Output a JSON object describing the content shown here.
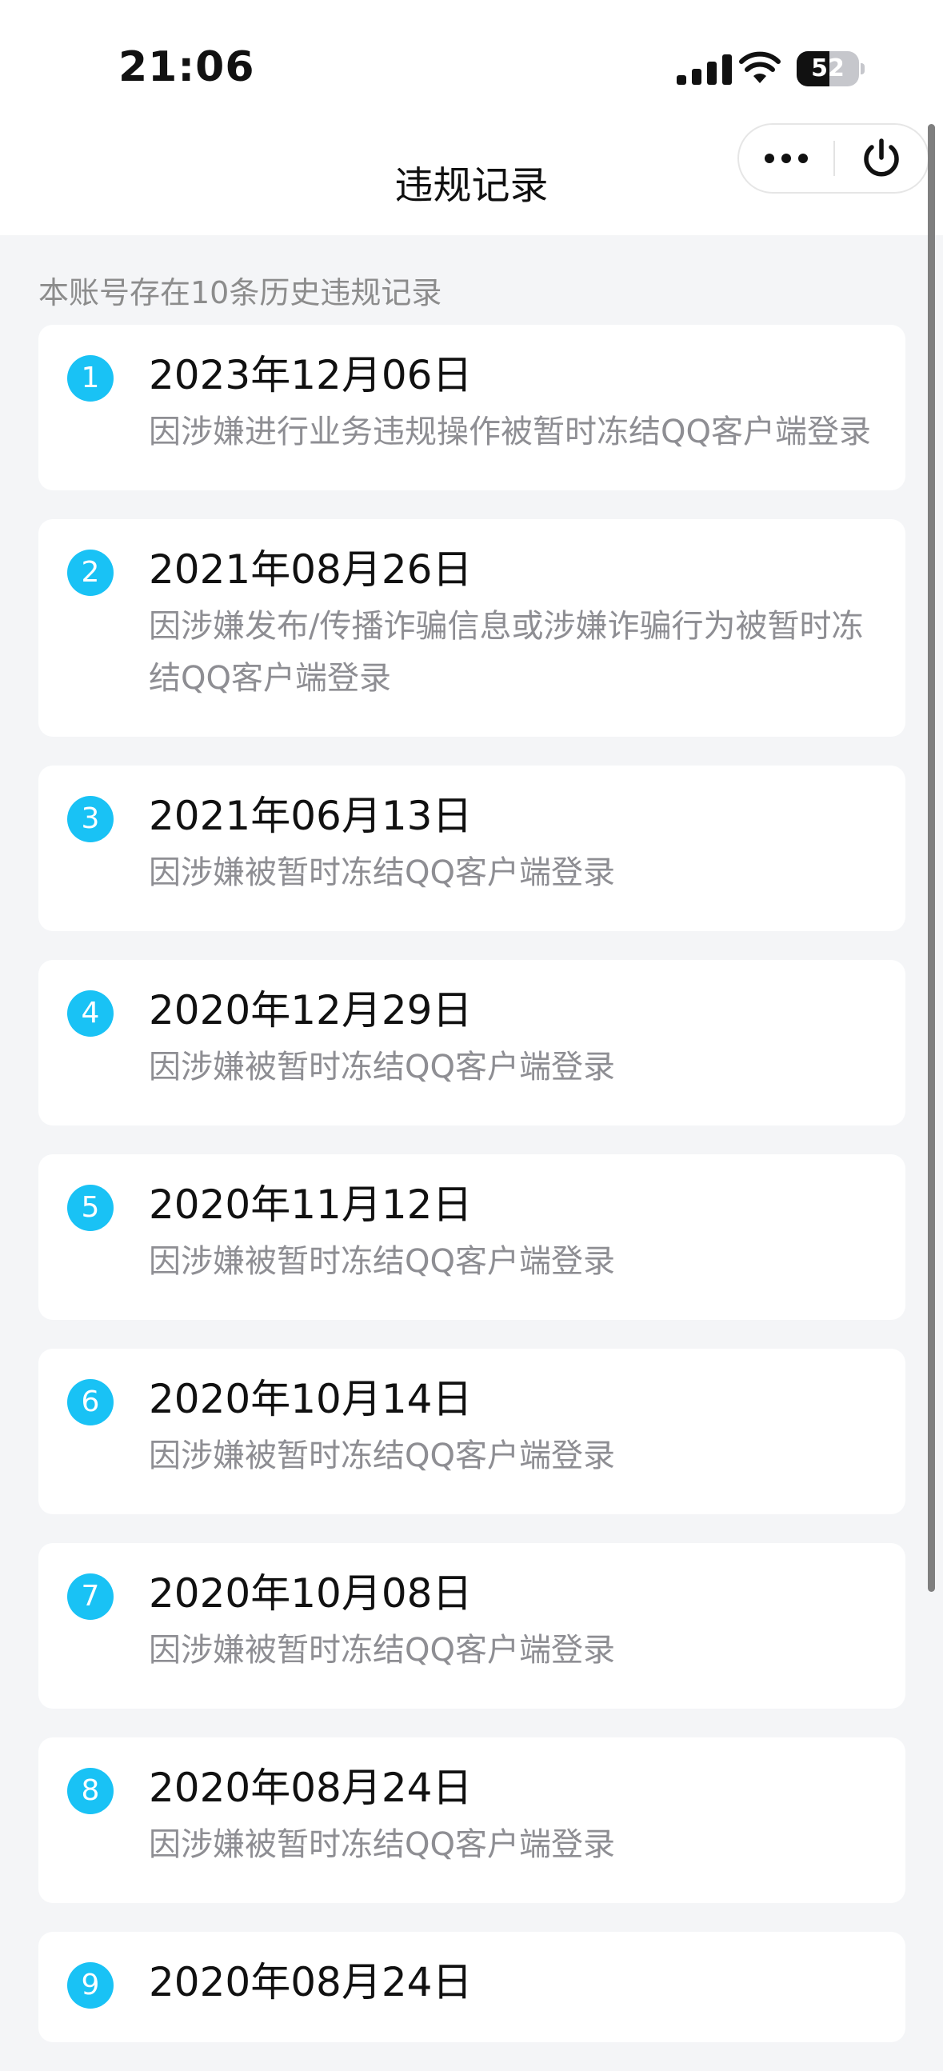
{
  "status_bar": {
    "time": "21:06",
    "battery": "52",
    "battery_level": 0.52
  },
  "nav": {
    "title": "违规记录"
  },
  "summary": "本账号存在10条历史违规记录",
  "records": [
    {
      "index": "1",
      "date": "2023年12月06日",
      "reason": "因涉嫌进行业务违规操作被暂时冻结QQ客户端登录"
    },
    {
      "index": "2",
      "date": "2021年08月26日",
      "reason": "因涉嫌发布/传播诈骗信息或涉嫌诈骗行为被暂时冻结QQ客户端登录"
    },
    {
      "index": "3",
      "date": "2021年06月13日",
      "reason": "因涉嫌被暂时冻结QQ客户端登录"
    },
    {
      "index": "4",
      "date": "2020年12月29日",
      "reason": "因涉嫌被暂时冻结QQ客户端登录"
    },
    {
      "index": "5",
      "date": "2020年11月12日",
      "reason": "因涉嫌被暂时冻结QQ客户端登录"
    },
    {
      "index": "6",
      "date": "2020年10月14日",
      "reason": "因涉嫌被暂时冻结QQ客户端登录"
    },
    {
      "index": "7",
      "date": "2020年10月08日",
      "reason": "因涉嫌被暂时冻结QQ客户端登录"
    },
    {
      "index": "8",
      "date": "2020年08月24日",
      "reason": "因涉嫌被暂时冻结QQ客户端登录"
    },
    {
      "index": "9",
      "date": "2020年08月24日",
      "reason": ""
    }
  ],
  "colors": {
    "badge": "#19c2f5",
    "background": "#f4f5f7",
    "card": "#ffffff",
    "secondary_text": "#8e8e93"
  },
  "icons": {
    "more": "more-dots-icon",
    "power": "power-icon",
    "signal": "cellular-signal-icon",
    "wifi": "wifi-icon",
    "battery": "battery-icon"
  }
}
